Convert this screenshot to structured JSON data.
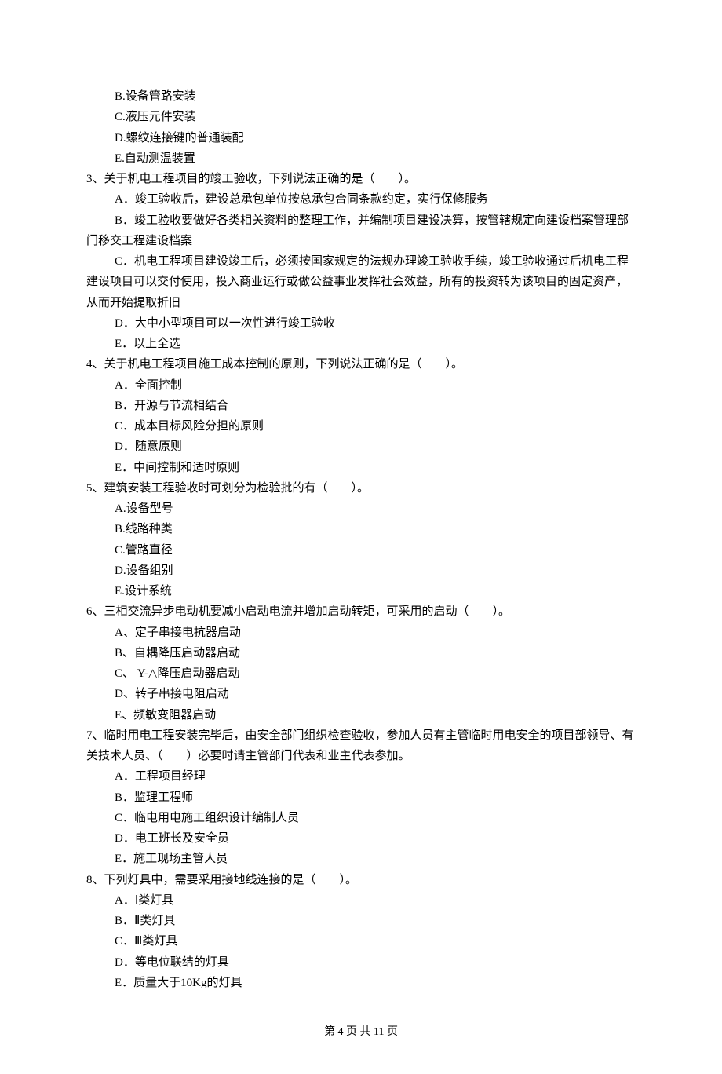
{
  "preOptions": [
    "B.设备管路安装",
    "C.液压元件安装",
    "D.螺纹连接键的普通装配",
    "E.自动测温装置"
  ],
  "q3": {
    "stem": "3、关于机电工程项目的竣工验收，下列说法正确的是（　　）。",
    "opts": [
      "A．竣工验收后，建设总承包单位按总承包合同条款约定，实行保修服务",
      "B．竣工验收要做好各类相关资料的整理工作，并编制项目建设决算，按管辖规定向建设档案管理部门移交工程建设档案",
      "C．机电工程项目建设竣工后，必须按国家规定的法规办理竣工验收手续，竣工验收通过后机电工程建设项目可以交付使用，投入商业运行或做公益事业发挥社会效益，所有的投资转为该项目的固定资产，从而开始提取折旧",
      "D．大中小型项目可以一次性进行竣工验收",
      "E．以上全选"
    ]
  },
  "q4": {
    "stem": "4、关于机电工程项目施工成本控制的原则，下列说法正确的是（　　）。",
    "opts": [
      "A．全面控制",
      "B．开源与节流相结合",
      "C．成本目标风险分担的原则",
      "D．随意原则",
      "E．中间控制和适时原则"
    ]
  },
  "q5": {
    "stem": "5、建筑安装工程验收时可划分为检验批的有（　　）。",
    "opts": [
      "A.设备型号",
      "B.线路种类",
      "C.管路直径",
      "D.设备组别",
      "E.设计系统"
    ]
  },
  "q6": {
    "stem": "6、三相交流异步电动机要减小启动电流并增加启动转矩，可采用的启动（　　）。",
    "opts": [
      "A、定子串接电抗器启动",
      "B、自耦降压启动器启动",
      "C、 Y-△降压启动器启动",
      "D、转子串接电阻启动",
      "E、频敏变阻器启动"
    ]
  },
  "q7": {
    "stem": "7、临时用电工程安装完毕后，由安全部门组织检查验收，参加人员有主管临时用电安全的项目部领导、有关技术人员、（　　）必要时请主管部门代表和业主代表参加。",
    "opts": [
      "A．工程项目经理",
      "B．监理工程师",
      "C．临电用电施工组织设计编制人员",
      "D．电工班长及安全员",
      "E．施工现场主管人员"
    ]
  },
  "q8": {
    "stem": "8、下列灯具中，需要采用接地线连接的是（　　）。",
    "opts": [
      "A．Ⅰ类灯具",
      "B．Ⅱ类灯具",
      "C．Ⅲ类灯具",
      "D．等电位联结的灯具",
      "E．质量大于10Kg的灯具"
    ]
  },
  "footer": "第 4 页 共 11 页"
}
